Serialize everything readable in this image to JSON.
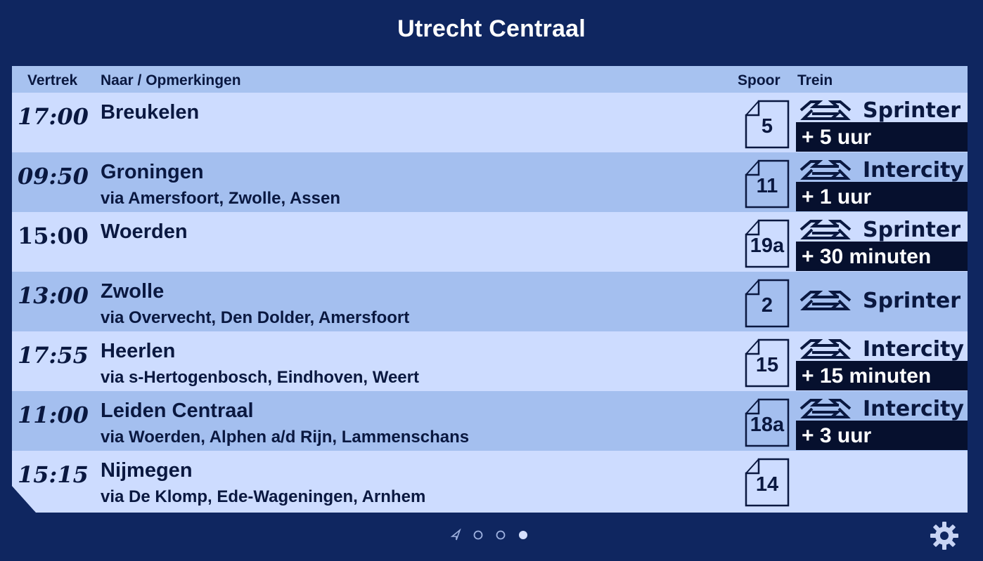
{
  "station": "Utrecht Centraal",
  "header": {
    "vertrek": "Vertrek",
    "naar": "Naar / Opmerkingen",
    "spoor": "Spoor",
    "trein": "Trein"
  },
  "departures": [
    {
      "time": "17:00",
      "destination": "Breukelen",
      "via": "",
      "platform": "5",
      "train": "Sprinter",
      "delay": "+ 5 uur"
    },
    {
      "time": "09:50",
      "destination": "Groningen",
      "via": "via Amersfoort, Zwolle, Assen",
      "platform": "11",
      "train": "Intercity",
      "delay": "+ 1 uur"
    },
    {
      "time": "15:00",
      "destination": "Woerden",
      "via": "",
      "platform": "19a",
      "train": "Sprinter",
      "delay": "+ 30 minuten"
    },
    {
      "time": "13:00",
      "destination": "Zwolle",
      "via": "via Overvecht, Den Dolder, Amersfoort",
      "platform": "2",
      "train": "Sprinter",
      "delay": ""
    },
    {
      "time": "17:55",
      "destination": "Heerlen",
      "via": "via s-Hertogenbosch, Eindhoven, Weert",
      "platform": "15",
      "train": "Intercity",
      "delay": "+ 15 minuten"
    },
    {
      "time": "11:00",
      "destination": "Leiden Centraal",
      "via": "via Woerden, Alphen a/d Rijn, Lammenschans",
      "platform": "18a",
      "train": "Intercity",
      "delay": "+ 3 uur"
    },
    {
      "time": "15:15",
      "destination": "Nijmegen",
      "via": "via De Klomp, Ede-Wageningen, Arnhem",
      "platform": "14",
      "train": "",
      "delay": ""
    }
  ],
  "icons": {
    "logo": "ns-logo-icon",
    "pager": [
      "location-arrow-icon",
      "page-dot-icon",
      "page-dot-icon",
      "page-dot-active-icon"
    ],
    "settings": "gear-icon"
  },
  "colors": {
    "background": "#0f2660",
    "row_light": "#cddcff",
    "row_dark": "#a4bfef",
    "delay_bg": "#06102e"
  }
}
